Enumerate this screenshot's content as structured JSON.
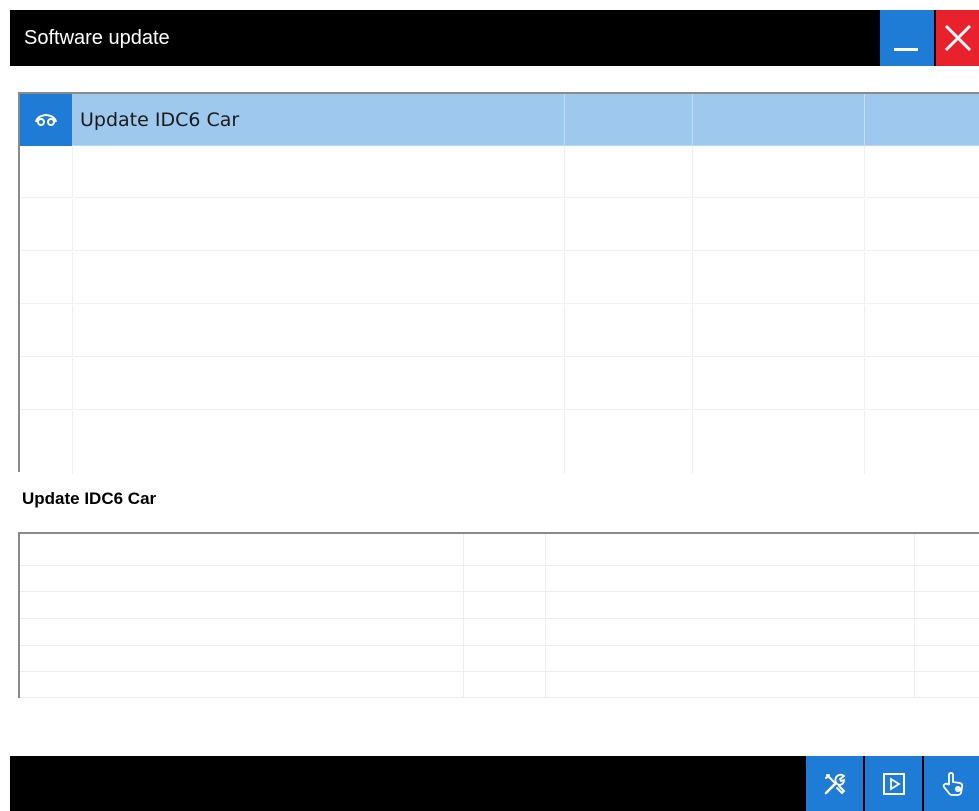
{
  "window": {
    "title": "Software update"
  },
  "list": {
    "rows": [
      {
        "label": "Update IDC6 Car",
        "icon": "car-icon",
        "selected": true
      }
    ]
  },
  "details": {
    "title": "Update IDC6 Car"
  },
  "toolbar": {
    "buttons": [
      {
        "name": "tools-button",
        "icon": "tools-icon"
      },
      {
        "name": "play-button",
        "icon": "play-icon"
      },
      {
        "name": "hand-button",
        "icon": "hand-pointer-icon"
      }
    ]
  },
  "colors": {
    "titlebar": "#000000",
    "accent_blue": "#1e7bd6",
    "close_red": "#e8212d",
    "selection": "#9ec8ee"
  }
}
